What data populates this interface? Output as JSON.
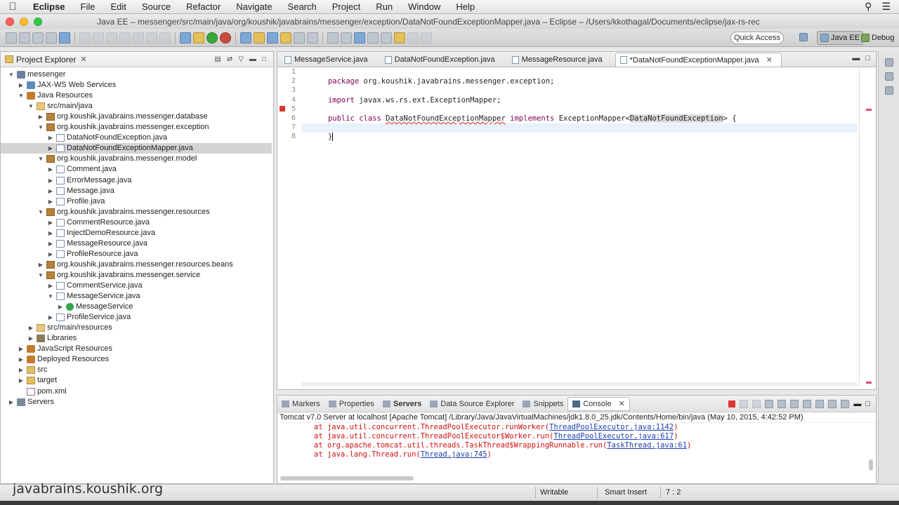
{
  "menubar": {
    "app_name": "Eclipse",
    "items": [
      "File",
      "Edit",
      "Source",
      "Refactor",
      "Navigate",
      "Search",
      "Project",
      "Run",
      "Window",
      "Help"
    ]
  },
  "window": {
    "title": "Java EE – messenger/src/main/java/org/koushik/javabrains/messenger/exception/DataNotFoundExceptionMapper.java – Eclipse – /Users/kkothagal/Documents/eclipse/jax-rs-rec"
  },
  "toolbar": {
    "quick_access": "Quick Access",
    "perspectives": [
      "Java EE",
      "Debug"
    ]
  },
  "explorer": {
    "title": "Project Explorer",
    "tree": [
      {
        "label": "messenger",
        "depth": 0,
        "twisty": "open",
        "icon": "project"
      },
      {
        "label": "JAX-WS Web Services",
        "depth": 1,
        "twisty": "closed",
        "icon": "ws"
      },
      {
        "label": "Java Resources",
        "depth": 1,
        "twisty": "open",
        "icon": "jres"
      },
      {
        "label": "src/main/java",
        "depth": 2,
        "twisty": "open",
        "icon": "srcfolder"
      },
      {
        "label": "org.koushik.javabrains.messenger.database",
        "depth": 3,
        "twisty": "closed",
        "icon": "pkg"
      },
      {
        "label": "org.koushik.javabrains.messenger.exception",
        "depth": 3,
        "twisty": "open",
        "icon": "pkg"
      },
      {
        "label": "DataNotFoundException.java",
        "depth": 4,
        "twisty": "closed",
        "icon": "java"
      },
      {
        "label": "DataNotFoundExceptionMapper.java",
        "depth": 4,
        "twisty": "closed",
        "icon": "java",
        "selected": true
      },
      {
        "label": "org.koushik.javabrains.messenger.model",
        "depth": 3,
        "twisty": "open",
        "icon": "pkg"
      },
      {
        "label": "Comment.java",
        "depth": 4,
        "twisty": "closed",
        "icon": "java"
      },
      {
        "label": "ErrorMessage.java",
        "depth": 4,
        "twisty": "closed",
        "icon": "java"
      },
      {
        "label": "Message.java",
        "depth": 4,
        "twisty": "closed",
        "icon": "java"
      },
      {
        "label": "Profile.java",
        "depth": 4,
        "twisty": "closed",
        "icon": "java"
      },
      {
        "label": "org.koushik.javabrains.messenger.resources",
        "depth": 3,
        "twisty": "open",
        "icon": "pkg"
      },
      {
        "label": "CommentResource.java",
        "depth": 4,
        "twisty": "closed",
        "icon": "java"
      },
      {
        "label": "InjectDemoResource.java",
        "depth": 4,
        "twisty": "closed",
        "icon": "java"
      },
      {
        "label": "MessageResource.java",
        "depth": 4,
        "twisty": "closed",
        "icon": "java"
      },
      {
        "label": "ProfileResource.java",
        "depth": 4,
        "twisty": "closed",
        "icon": "java"
      },
      {
        "label": "org.koushik.javabrains.messenger.resources.beans",
        "depth": 3,
        "twisty": "closed",
        "icon": "pkg"
      },
      {
        "label": "org.koushik.javabrains.messenger.service",
        "depth": 3,
        "twisty": "open",
        "icon": "pkg"
      },
      {
        "label": "CommentService.java",
        "depth": 4,
        "twisty": "closed",
        "icon": "java"
      },
      {
        "label": "MessageService.java",
        "depth": 4,
        "twisty": "open",
        "icon": "java"
      },
      {
        "label": "MessageService",
        "depth": 5,
        "twisty": "closed",
        "icon": "cls"
      },
      {
        "label": "ProfileService.java",
        "depth": 4,
        "twisty": "closed",
        "icon": "java"
      },
      {
        "label": "src/main/resources",
        "depth": 2,
        "twisty": "closed",
        "icon": "srcfolder"
      },
      {
        "label": "Libraries",
        "depth": 2,
        "twisty": "closed",
        "icon": "lib"
      },
      {
        "label": "JavaScript Resources",
        "depth": 1,
        "twisty": "closed",
        "icon": "jres"
      },
      {
        "label": "Deployed Resources",
        "depth": 1,
        "twisty": "closed",
        "icon": "jres"
      },
      {
        "label": "src",
        "depth": 1,
        "twisty": "closed",
        "icon": "folder"
      },
      {
        "label": "target",
        "depth": 1,
        "twisty": "closed",
        "icon": "folder"
      },
      {
        "label": "pom.xml",
        "depth": 1,
        "twisty": "none",
        "icon": "xml"
      },
      {
        "label": "Servers",
        "depth": 0,
        "twisty": "closed",
        "icon": "srv"
      }
    ]
  },
  "editor": {
    "tabs": [
      {
        "label": "MessageService.java",
        "active": false
      },
      {
        "label": "DataNotFoundException.java",
        "active": false
      },
      {
        "label": "MessageResource.java",
        "active": false
      },
      {
        "label": "*DataNotFoundExceptionMapper.java",
        "active": true
      }
    ],
    "line_numbers": [
      "1",
      "2",
      "3",
      "4",
      "5",
      "6",
      "7",
      "8"
    ],
    "lines": {
      "l1_kw": "package",
      "l1_rest": " org.koushik.javabrains.messenger.exception;",
      "l3_kw": "import",
      "l3_rest": " javax.ws.rs.ext.ExceptionMapper;",
      "l5_kw1": "public",
      "l5_kw2": "class",
      "l5_name": "DataNotFoundExceptionMapper",
      "l5_kw3": "implements",
      "l5_iface": " ExceptionMapper<",
      "l5_type": "DataNotFoundException",
      "l5_end": "> {",
      "l7": "}"
    }
  },
  "console": {
    "tabs": [
      "Markers",
      "Properties",
      "Servers",
      "Data Source Explorer",
      "Snippets",
      "Console"
    ],
    "active_tab": "Console",
    "description": "Tomcat v7.0 Server at localhost [Apache Tomcat] /Library/Java/JavaVirtualMachines/jdk1.8.0_25.jdk/Contents/Home/bin/java (May 10, 2015, 4:42:52 PM)",
    "lines": [
      {
        "pre": "at java.util.concurrent.ThreadPoolExecutor.runWorker(",
        "link": "ThreadPoolExecutor.java:1142",
        "post": ")"
      },
      {
        "pre": "at java.util.concurrent.ThreadPoolExecutor$Worker.run(",
        "link": "ThreadPoolExecutor.java:617",
        "post": ")"
      },
      {
        "pre": "at org.apache.tomcat.util.threads.TaskThread$WrappingRunnable.run(",
        "link": "TaskThread.java:61",
        "post": ")"
      },
      {
        "pre": "at java.lang.Thread.run(",
        "link": "Thread.java:745",
        "post": ")"
      }
    ]
  },
  "statusbar": {
    "writable": "Writable",
    "insert_mode": "Smart Insert",
    "position": "7 : 2"
  },
  "watermark": "javabrains.koushik.org",
  "colors": {
    "keyword": "#7f0055",
    "error": "#d33333",
    "console_error": "#d01010",
    "link": "#1a3fb0",
    "selection": "#d4d4d4"
  }
}
